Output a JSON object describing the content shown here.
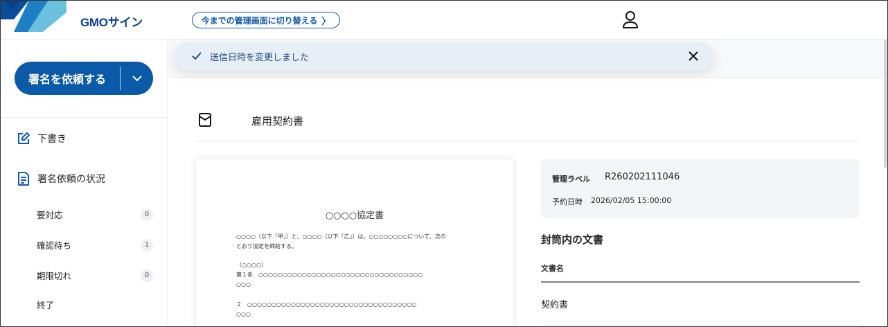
{
  "header": {
    "brand": "GMOサイン",
    "switch_label": "今までの管理画面に切り替える",
    "switch_chevron": "〉"
  },
  "toast": {
    "message": "送信日時を変更しました"
  },
  "sidebar": {
    "request_button": "署名を依頼する",
    "nav": [
      {
        "label": "下書き",
        "icon": "edit-icon"
      },
      {
        "label": "署名依頼の状況",
        "icon": "document-list-icon"
      }
    ],
    "status_items": [
      {
        "label": "要対応",
        "count": "0"
      },
      {
        "label": "確認待ち",
        "count": "1"
      },
      {
        "label": "期限切れ",
        "count": "0"
      },
      {
        "label": "終了",
        "count": ""
      }
    ]
  },
  "document": {
    "title": "雇用契約書",
    "preview": {
      "heading": "○○○○協定書",
      "lines": [
        "○○○○（以下「甲」）と、○○○○（以下「乙」）は、○○○○○○○○について、次の",
        "とおり協定を締結する。",
        "（○○○○）",
        "第１条　○○○○○○○○○○○○○○○○○○○○○○○○○○○○○○○○○○",
        "○○○",
        "２　○○○○○○○○○○○○○○○○○○○○○○○○○○○○○○○○○○○",
        "○○○"
      ]
    }
  },
  "info": {
    "label_key": "管理ラベル",
    "label_value": "R260202111046",
    "schedule_key": "予約日時",
    "schedule_value": "2026/02/05 15:00:00"
  },
  "envelope": {
    "heading": "封筒内の文書",
    "column": "文書名",
    "rows": [
      "契約書"
    ]
  },
  "colors": {
    "primary": "#0a5aa8",
    "brand_text": "#0a3f8c",
    "toast_bg": "#e7eef5",
    "logo_dark": "#0a4d99",
    "logo_light": "#5fb6d8"
  }
}
